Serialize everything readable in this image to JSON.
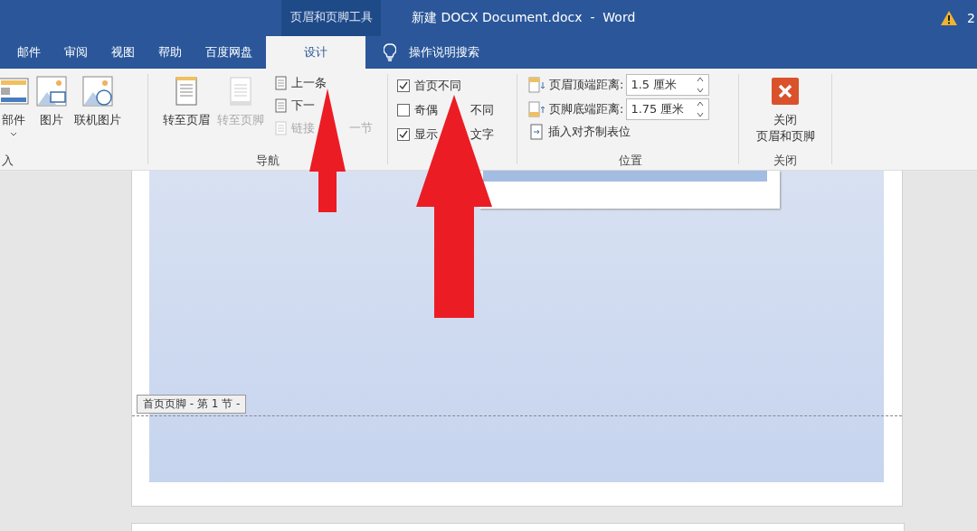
{
  "title_bar": {
    "context_group": "页眉和页脚工具",
    "title": "新建 DOCX Document.docx  -  Word",
    "account_text": "2"
  },
  "tabs": [
    {
      "label": "邮件",
      "selected": false
    },
    {
      "label": "审阅",
      "selected": false
    },
    {
      "label": "视图",
      "selected": false
    },
    {
      "label": "帮助",
      "selected": false
    },
    {
      "label": "百度网盘",
      "selected": false
    },
    {
      "label": "设计",
      "selected": true
    }
  ],
  "tell_me": {
    "placeholder": "操作说明搜索"
  },
  "insert_group": {
    "label": "入",
    "buttons": [
      {
        "label": "部件",
        "has_menu": true
      },
      {
        "label": "图片",
        "has_menu": false
      },
      {
        "label": "联机图片",
        "has_menu": false
      }
    ]
  },
  "navigation": {
    "label": "导航",
    "large_buttons": [
      {
        "label": "转至页眉",
        "disabled": false
      },
      {
        "label": "转至页脚",
        "disabled": true
      }
    ],
    "small_buttons": [
      {
        "parts": [
          "上一条"
        ],
        "disabled": false
      },
      {
        "parts": [
          "下一"
        ],
        "disabled": false
      },
      {
        "parts": [
          "链接",
          "一节"
        ],
        "disabled": true
      }
    ]
  },
  "options": {
    "checkboxes": [
      {
        "parts": [
          "首页不同"
        ],
        "checked": true
      },
      {
        "parts": [
          "奇偶",
          "不同"
        ],
        "checked": false
      },
      {
        "parts": [
          "显示",
          "文字"
        ],
        "checked": true
      }
    ]
  },
  "position": {
    "label": "位置",
    "spinners": [
      {
        "label": "页眉顶端距离:",
        "value": "1.5 厘米"
      },
      {
        "label": "页脚底端距离:",
        "value": "1.75 厘米"
      }
    ],
    "insert_tab": "插入对齐制表位"
  },
  "close": {
    "label": "关闭",
    "button_lines": [
      "关闭",
      "页眉和页脚"
    ]
  },
  "document": {
    "section_label": "首页页脚 - 第 1 节 -"
  }
}
